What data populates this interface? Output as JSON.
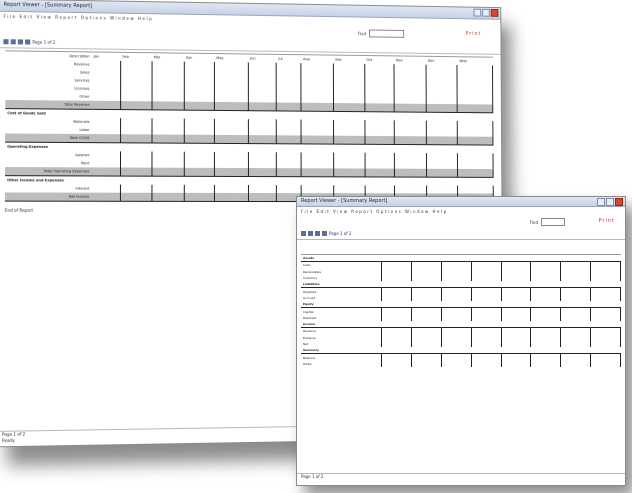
{
  "window": {
    "title": "Report Viewer - [Summary Report]",
    "menu": "File  Edit  View  Report  Options  Window  Help",
    "red_link": "Print",
    "search_label": "Find",
    "toolbar_text": "Page 1 of 2",
    "status_text": "Page 1 of 2",
    "status_sub": "Ready"
  },
  "back_report": {
    "header": [
      "Description",
      "Jan",
      "Feb",
      "Mar",
      "Apr",
      "May",
      "Jun",
      "Jul",
      "Aug",
      "Sep",
      "Oct",
      "Nov",
      "Dec",
      "Total"
    ],
    "sections": [
      {
        "title": "",
        "rows": [
          "Revenue",
          "Sales",
          "Services",
          "Licenses",
          "Other"
        ],
        "total": "Total Revenue"
      },
      {
        "title": "Cost of Goods Sold",
        "rows": [
          "Materials",
          "Labor"
        ],
        "total": "Total COGS"
      },
      {
        "title": "Operating Expenses",
        "rows": [
          "Salaries",
          "Rent"
        ],
        "total": "Total Operating Expenses"
      },
      {
        "title": "Other Income and Expenses",
        "rows": [
          "Interest"
        ],
        "total": "Net Income"
      }
    ],
    "footer": "End of Report"
  },
  "front_report": {
    "sections": [
      {
        "title": "Assets",
        "rows": [
          "Cash",
          "Receivables",
          "Inventory"
        ]
      },
      {
        "title": "Liabilities",
        "rows": [
          "Payables",
          "Accrued"
        ]
      },
      {
        "title": "Equity",
        "rows": [
          "Capital",
          "Retained"
        ]
      },
      {
        "title": "Income",
        "rows": [
          "Revenue",
          "Expense",
          "Net"
        ]
      },
      {
        "title": "Summary",
        "rows": [
          "Balance",
          "Totals"
        ]
      }
    ]
  }
}
